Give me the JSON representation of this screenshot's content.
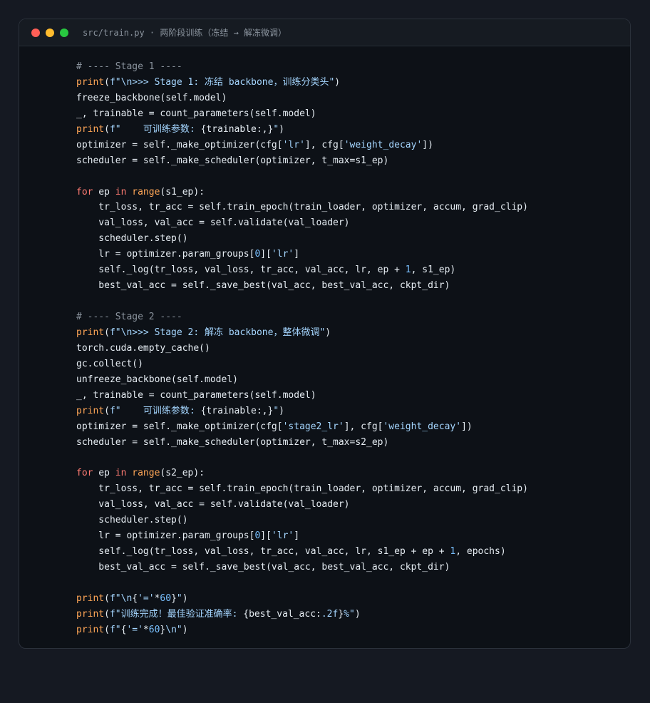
{
  "window": {
    "title": "src/train.py · 两阶段训练（冻结 → 解冻微调）",
    "dots": [
      {
        "name": "close",
        "color": "#ff5f57"
      },
      {
        "name": "minimize",
        "color": "#febc2e"
      },
      {
        "name": "maximize",
        "color": "#28c840"
      }
    ]
  },
  "colors": {
    "page_bg": "#151922",
    "window_bg": "#0d1117",
    "titlebar_bg": "#161b22",
    "keyword": "#ff7b72",
    "builtin": "#ffa657",
    "string": "#a5d6ff",
    "number": "#79c0ff",
    "comment": "#8b949e",
    "plain": "#e6edf3"
  },
  "code": {
    "lines": [
      [
        [
          "comment",
          "# ---- Stage 1 ----"
        ]
      ],
      [
        [
          "builtin",
          "print"
        ],
        [
          "plain",
          "("
        ],
        [
          "string",
          "f\"\\n>>> Stage 1: 冻结 backbone，训练分类头\""
        ],
        [
          "plain",
          ")"
        ]
      ],
      [
        [
          "plain",
          "freeze_backbone(self.model)"
        ]
      ],
      [
        [
          "plain",
          "_, trainable = count_parameters(self.model)"
        ]
      ],
      [
        [
          "builtin",
          "print"
        ],
        [
          "plain",
          "("
        ],
        [
          "string",
          "f\"    可训练参数: "
        ],
        [
          "plain",
          "{trainable:,}"
        ],
        [
          "string",
          "\""
        ],
        [
          "plain",
          ")"
        ]
      ],
      [
        [
          "plain",
          "optimizer = self._make_optimizer(cfg["
        ],
        [
          "string",
          "'lr'"
        ],
        [
          "plain",
          "], cfg["
        ],
        [
          "string",
          "'weight_decay'"
        ],
        [
          "plain",
          "])"
        ]
      ],
      [
        [
          "plain",
          "scheduler = self._make_scheduler(optimizer, t_max=s1_ep)"
        ]
      ],
      [],
      [
        [
          "keyword",
          "for"
        ],
        [
          "plain",
          " ep "
        ],
        [
          "keyword",
          "in"
        ],
        [
          "plain",
          " "
        ],
        [
          "builtin",
          "range"
        ],
        [
          "plain",
          "(s1_ep):"
        ]
      ],
      [
        [
          "plain",
          "    tr_loss, tr_acc = self.train_epoch(train_loader, optimizer, accum, grad_clip)"
        ]
      ],
      [
        [
          "plain",
          "    val_loss, val_acc = self.validate(val_loader)"
        ]
      ],
      [
        [
          "plain",
          "    scheduler.step()"
        ]
      ],
      [
        [
          "plain",
          "    lr = optimizer.param_groups["
        ],
        [
          "number",
          "0"
        ],
        [
          "plain",
          "]["
        ],
        [
          "string",
          "'lr'"
        ],
        [
          "plain",
          "]"
        ]
      ],
      [
        [
          "plain",
          "    self._log(tr_loss, val_loss, tr_acc, val_acc, lr, ep + "
        ],
        [
          "number",
          "1"
        ],
        [
          "plain",
          ", s1_ep)"
        ]
      ],
      [
        [
          "plain",
          "    best_val_acc = self._save_best(val_acc, best_val_acc, ckpt_dir)"
        ]
      ],
      [],
      [
        [
          "comment",
          "# ---- Stage 2 ----"
        ]
      ],
      [
        [
          "builtin",
          "print"
        ],
        [
          "plain",
          "("
        ],
        [
          "string",
          "f\"\\n>>> Stage 2: 解冻 backbone，整体微调\""
        ],
        [
          "plain",
          ")"
        ]
      ],
      [
        [
          "plain",
          "torch.cuda.empty_cache()"
        ]
      ],
      [
        [
          "plain",
          "gc.collect()"
        ]
      ],
      [
        [
          "plain",
          "unfreeze_backbone(self.model)"
        ]
      ],
      [
        [
          "plain",
          "_, trainable = count_parameters(self.model)"
        ]
      ],
      [
        [
          "builtin",
          "print"
        ],
        [
          "plain",
          "("
        ],
        [
          "string",
          "f\"    可训练参数: "
        ],
        [
          "plain",
          "{trainable:,}"
        ],
        [
          "string",
          "\""
        ],
        [
          "plain",
          ")"
        ]
      ],
      [
        [
          "plain",
          "optimizer = self._make_optimizer(cfg["
        ],
        [
          "string",
          "'stage2_lr'"
        ],
        [
          "plain",
          "], cfg["
        ],
        [
          "string",
          "'weight_decay'"
        ],
        [
          "plain",
          "])"
        ]
      ],
      [
        [
          "plain",
          "scheduler = self._make_scheduler(optimizer, t_max=s2_ep)"
        ]
      ],
      [],
      [
        [
          "keyword",
          "for"
        ],
        [
          "plain",
          " ep "
        ],
        [
          "keyword",
          "in"
        ],
        [
          "plain",
          " "
        ],
        [
          "builtin",
          "range"
        ],
        [
          "plain",
          "(s2_ep):"
        ]
      ],
      [
        [
          "plain",
          "    tr_loss, tr_acc = self.train_epoch(train_loader, optimizer, accum, grad_clip)"
        ]
      ],
      [
        [
          "plain",
          "    val_loss, val_acc = self.validate(val_loader)"
        ]
      ],
      [
        [
          "plain",
          "    scheduler.step()"
        ]
      ],
      [
        [
          "plain",
          "    lr = optimizer.param_groups["
        ],
        [
          "number",
          "0"
        ],
        [
          "plain",
          "]["
        ],
        [
          "string",
          "'lr'"
        ],
        [
          "plain",
          "]"
        ]
      ],
      [
        [
          "plain",
          "    self._log(tr_loss, val_loss, tr_acc, val_acc, lr, s1_ep + ep + "
        ],
        [
          "number",
          "1"
        ],
        [
          "plain",
          ", epochs)"
        ]
      ],
      [
        [
          "plain",
          "    best_val_acc = self._save_best(val_acc, best_val_acc, ckpt_dir)"
        ]
      ],
      [],
      [
        [
          "builtin",
          "print"
        ],
        [
          "plain",
          "("
        ],
        [
          "string",
          "f\"\\n"
        ],
        [
          "plain",
          "{"
        ],
        [
          "string",
          "'='"
        ],
        [
          "plain",
          "*"
        ],
        [
          "number",
          "60"
        ],
        [
          "plain",
          "}"
        ],
        [
          "string",
          "\""
        ],
        [
          "plain",
          ")"
        ]
      ],
      [
        [
          "builtin",
          "print"
        ],
        [
          "plain",
          "("
        ],
        [
          "string",
          "f\"训练完成！最佳验证准确率: "
        ],
        [
          "plain",
          "{best_val_acc:"
        ],
        [
          "string",
          ".2f"
        ],
        [
          "plain",
          "}"
        ],
        [
          "string",
          "%\""
        ],
        [
          "plain",
          ")"
        ]
      ],
      [
        [
          "builtin",
          "print"
        ],
        [
          "plain",
          "("
        ],
        [
          "string",
          "f\""
        ],
        [
          "plain",
          "{"
        ],
        [
          "string",
          "'='"
        ],
        [
          "plain",
          "*"
        ],
        [
          "number",
          "60"
        ],
        [
          "plain",
          "}"
        ],
        [
          "string",
          "\\n\""
        ],
        [
          "plain",
          ")"
        ]
      ]
    ]
  }
}
